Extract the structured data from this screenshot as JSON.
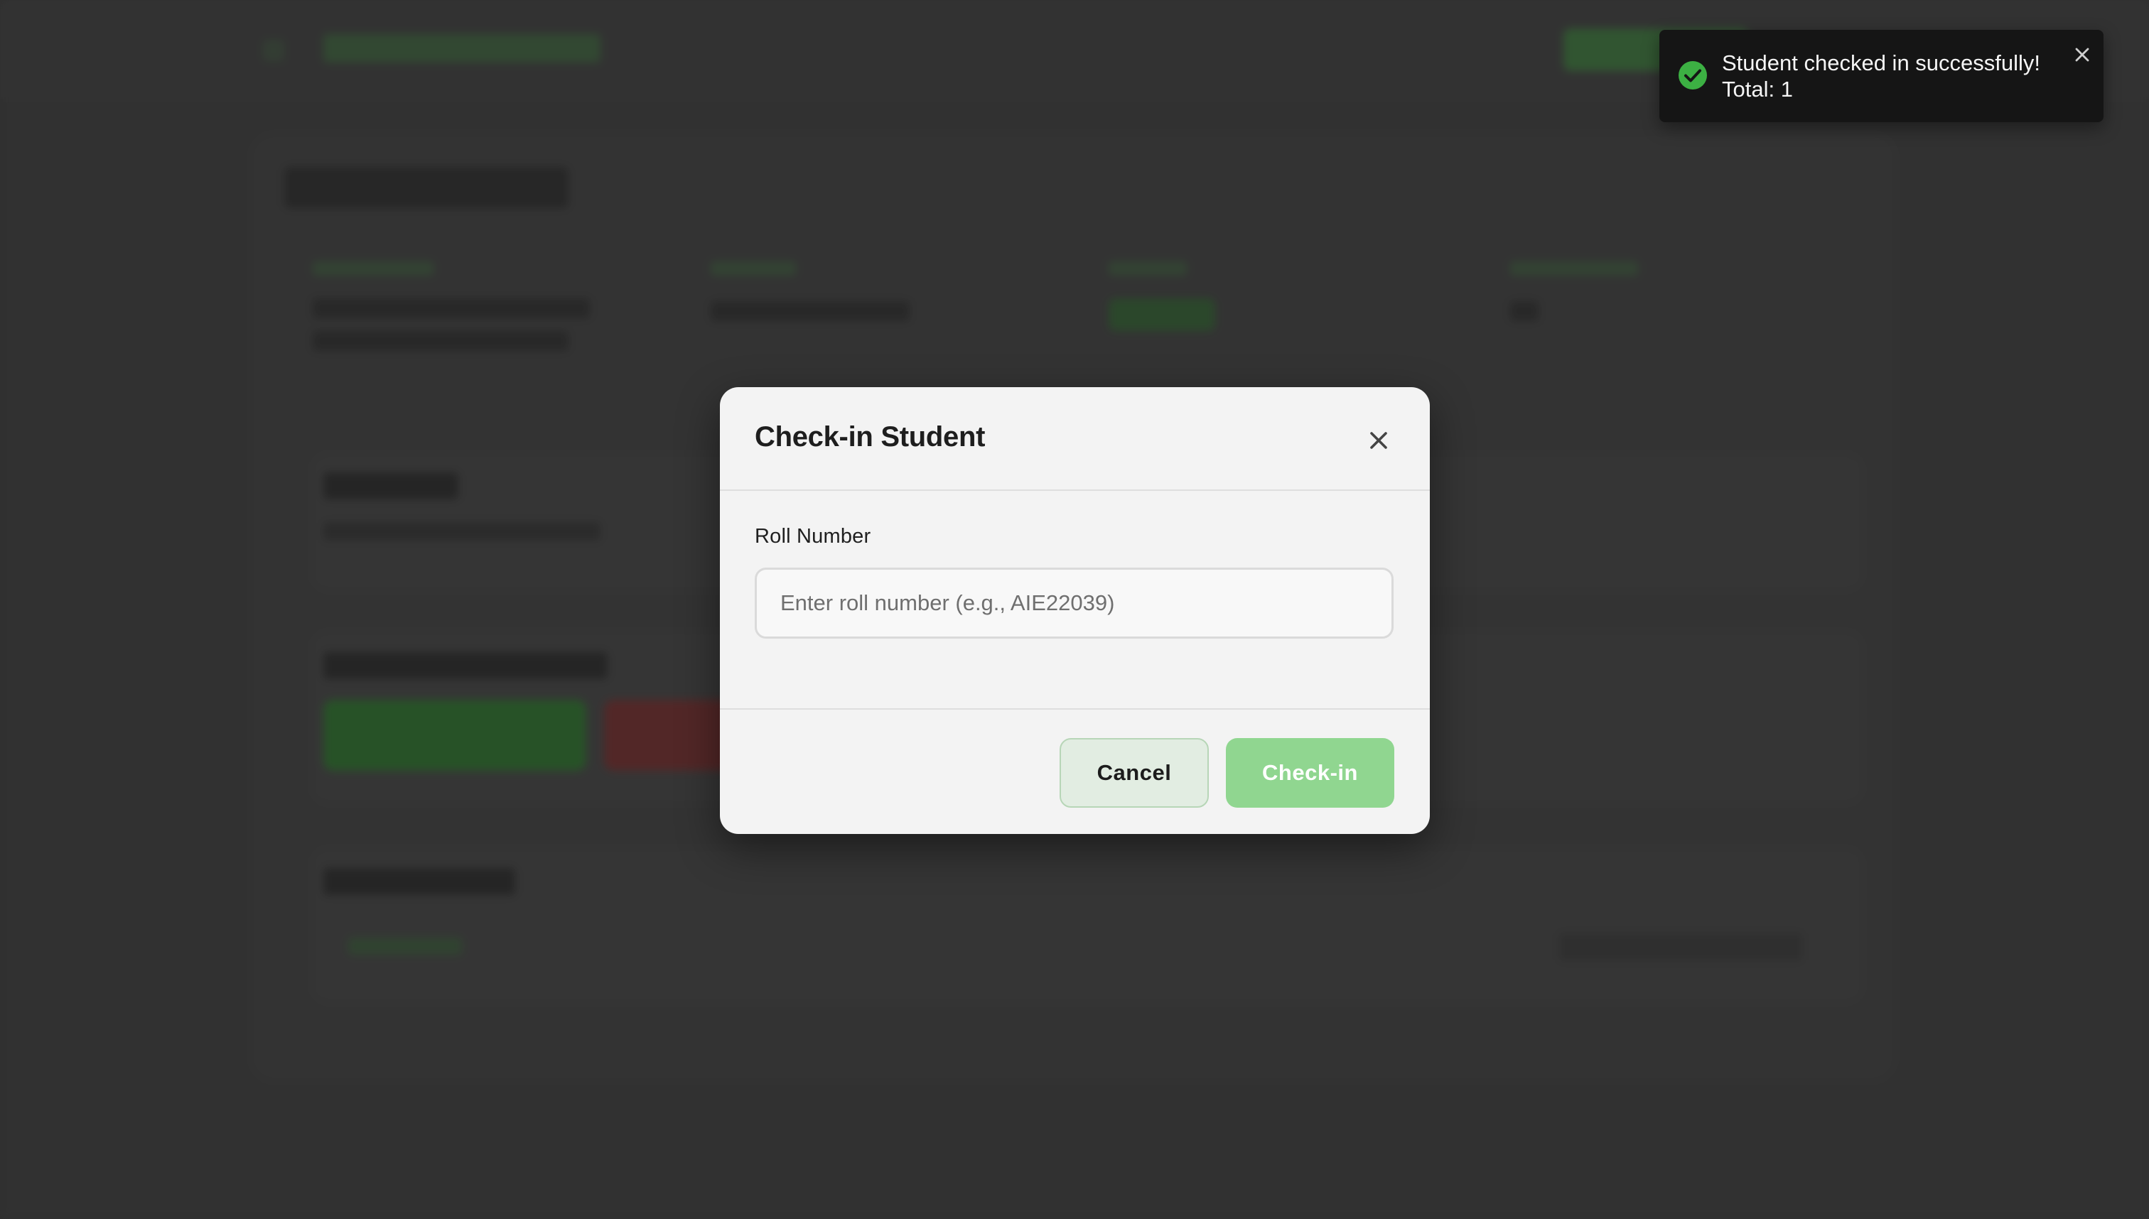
{
  "modal": {
    "title": "Check-in Student",
    "close_icon": "close-icon",
    "field_label": "Roll Number",
    "input_value": "",
    "input_placeholder": "Enter roll number (e.g., AIE22039)",
    "cancel_label": "Cancel",
    "submit_label": "Check-in"
  },
  "toast": {
    "status_icon": "check-circle-icon",
    "line1": "Student checked in successfully!",
    "line2": "Total: 1",
    "close_icon": "close-icon"
  },
  "colors": {
    "accent": "#90d690",
    "success": "#3cb043",
    "overlay": "#3a3a3a",
    "toast_bg": "#151515"
  }
}
